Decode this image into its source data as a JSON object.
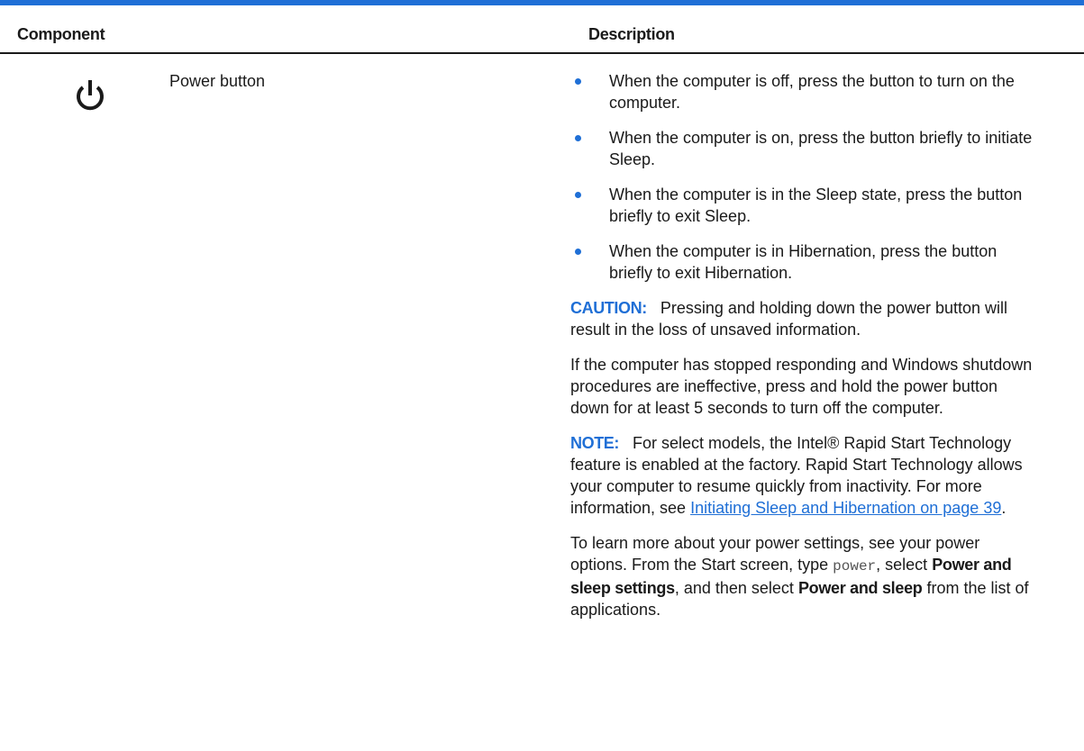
{
  "table": {
    "header": {
      "component": "Component",
      "description": "Description"
    },
    "row": {
      "icon": "power-icon",
      "component_name": "Power button",
      "bullets": [
        "When the computer is off, press the button to turn on the computer.",
        "When the computer is on, press the button briefly to initiate Sleep.",
        "When the computer is in the Sleep state, press the button briefly to exit Sleep.",
        "When the computer is in Hibernation, press the button briefly to exit Hibernation."
      ],
      "caution": {
        "label": "CAUTION:",
        "text": "Pressing and holding down the power button will result in the loss of unsaved information."
      },
      "unresponsive_text": "If the computer has stopped responding and Windows shutdown procedures are ineffective, press and hold the power button down for at least 5 seconds to turn off the computer.",
      "note": {
        "label": "NOTE:",
        "text": "For select models, the Intel® Rapid Start Technology feature is enabled at the factory. Rapid Start Technology allows your computer to resume quickly from inactivity. For more information, see ",
        "link_text": "Initiating Sleep and Hibernation on page 39",
        "after_link": "."
      },
      "settings": {
        "t1": "To learn more about your power settings, see your power options. From the Start screen, type ",
        "code": "power",
        "t2": ", select ",
        "b1": "Power and sleep settings",
        "t3": ", and then select ",
        "b2": "Power and sleep",
        "t4": " from the list of applications."
      }
    }
  },
  "colors": {
    "accent": "#1f6fd6",
    "text": "#1a1a1a"
  }
}
